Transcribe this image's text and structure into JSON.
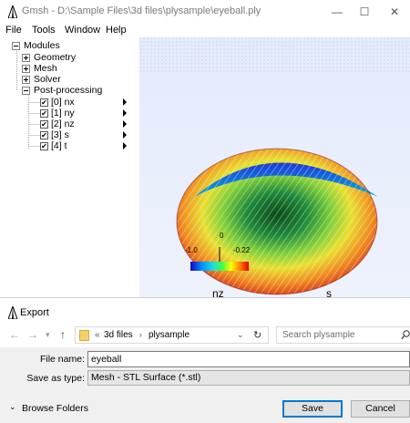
{
  "window": {
    "title": "Gmsh - D:\\Sample Files\\3d files\\plysample\\eyeball.ply",
    "minimize_glyph": "—",
    "maximize_glyph": "☐",
    "close_glyph": "✕"
  },
  "menu": {
    "file": "File",
    "tools": "Tools",
    "window": "Window",
    "help": "Help"
  },
  "tree": {
    "modules": "Modules",
    "geometry": "Geometry",
    "mesh": "Mesh",
    "solver": "Solver",
    "post_processing": "Post-processing",
    "views": [
      "[0] nx",
      "[1] ny",
      "[2] nz",
      "[3] s",
      "[4] t"
    ],
    "check_glyph": "✔"
  },
  "viewport": {
    "colorbar_min": "-1.0",
    "colorbar_mid": "0",
    "colorbar_max": "-0.22",
    "axis_label_left": "nz",
    "axis_label_right": "s",
    "colors": [
      "#2c3cff",
      "#00c8ff",
      "#3cff3c",
      "#ffff00",
      "#ff8000",
      "#e00000"
    ]
  },
  "dialog": {
    "title": "Export",
    "breadcrumb_prefix": "«",
    "path_parts": [
      "3d files",
      "plysample"
    ],
    "search_placeholder": "Search plysample",
    "file_name_label": "File name:",
    "file_name_value": "eyeball",
    "save_as_label": "Save as type:",
    "save_as_value": "Mesh - STL Surface (*.stl)",
    "browse_folders": "Browse Folders",
    "save_button": "Save",
    "cancel_button": "Cancel"
  }
}
